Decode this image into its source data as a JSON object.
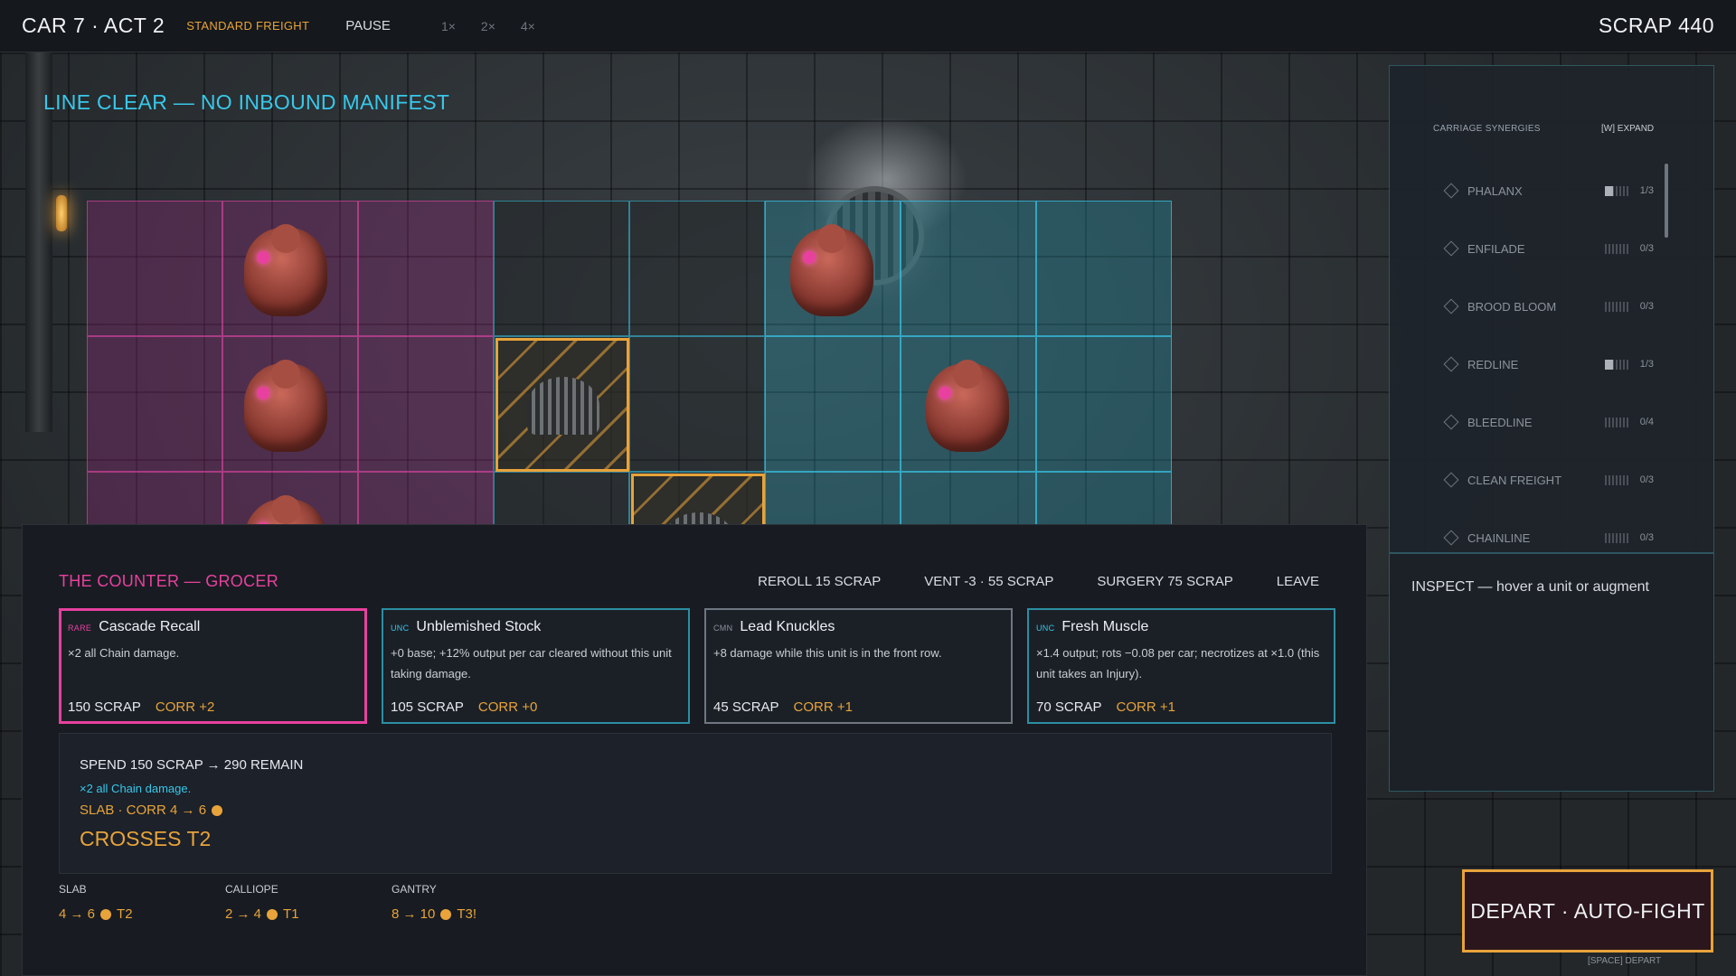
{
  "topbar": {
    "title": "CAR 7 · ACT 2",
    "mode": "STANDARD FREIGHT",
    "pause": "PAUSE",
    "speeds": [
      "1×",
      "2×",
      "4×"
    ],
    "scrap": "SCRAP 440"
  },
  "line_clear": "LINE CLEAR — NO INBOUND MANIFEST",
  "synergies": {
    "header": "CARRIAGE SYNERGIES",
    "expand": "[W] EXPAND",
    "items": [
      {
        "name": "PHALANX",
        "count": "1/3",
        "fill": 0.33
      },
      {
        "name": "ENFILADE",
        "count": "0/3",
        "fill": 0
      },
      {
        "name": "BROOD BLOOM",
        "count": "0/3",
        "fill": 0
      },
      {
        "name": "REDLINE",
        "count": "1/3",
        "fill": 0.33
      },
      {
        "name": "BLEEDLINE",
        "count": "0/4",
        "fill": 0
      },
      {
        "name": "CLEAN FREIGHT",
        "count": "0/3",
        "fill": 0
      },
      {
        "name": "CHAINLINE",
        "count": "0/3",
        "fill": 0
      }
    ]
  },
  "inspect": "INSPECT — hover a unit or augment",
  "shop": {
    "title": "THE COUNTER — GROCER",
    "actions": {
      "reroll": "REROLL 15 SCRAP",
      "vent": "VENT -3 · 55 SCRAP",
      "surgery": "SURGERY 75 SCRAP",
      "leave": "LEAVE"
    },
    "cards": [
      {
        "rarity": "RARE",
        "name": "Cascade Recall",
        "desc": "×2 all Chain damage.",
        "price": "150 SCRAP",
        "corr": "CORR +2"
      },
      {
        "rarity": "UNC",
        "name": "Unblemished Stock",
        "desc": "+0 base; +12% output per car cleared without this unit taking damage.",
        "price": "105 SCRAP",
        "corr": "CORR +0"
      },
      {
        "rarity": "CMN",
        "name": "Lead Knuckles",
        "desc": "+8 damage while this unit is in the front row.",
        "price": "45 SCRAP",
        "corr": "CORR +1"
      },
      {
        "rarity": "UNC",
        "name": "Fresh Muscle",
        "desc": "×1.4 output; rots −0.08 per car; necrotizes at ×1.0 (this unit takes an Injury).",
        "price": "70 SCRAP",
        "corr": "CORR +1"
      }
    ],
    "spend": {
      "line": "SPEND 150 SCRAP → 290 REMAIN",
      "effect": "×2 all Chain damage.",
      "corr": "SLAB · CORR 4 → 6",
      "cross": "CROSSES T2"
    },
    "teams": [
      {
        "name": "SLAB",
        "value": "4 → 6",
        "tier": "T2"
      },
      {
        "name": "CALLIOPE",
        "value": "2 → 4",
        "tier": "T1"
      },
      {
        "name": "GANTRY",
        "value": "8 → 10",
        "tier": "T3!"
      }
    ]
  },
  "depart": {
    "label": "DEPART · AUTO-FIGHT",
    "hint": "[SPACE] DEPART"
  },
  "colors": {
    "accent_pink": "#e8409e",
    "accent_cyan": "#38c8ea",
    "accent_amber": "#e8a33a"
  }
}
